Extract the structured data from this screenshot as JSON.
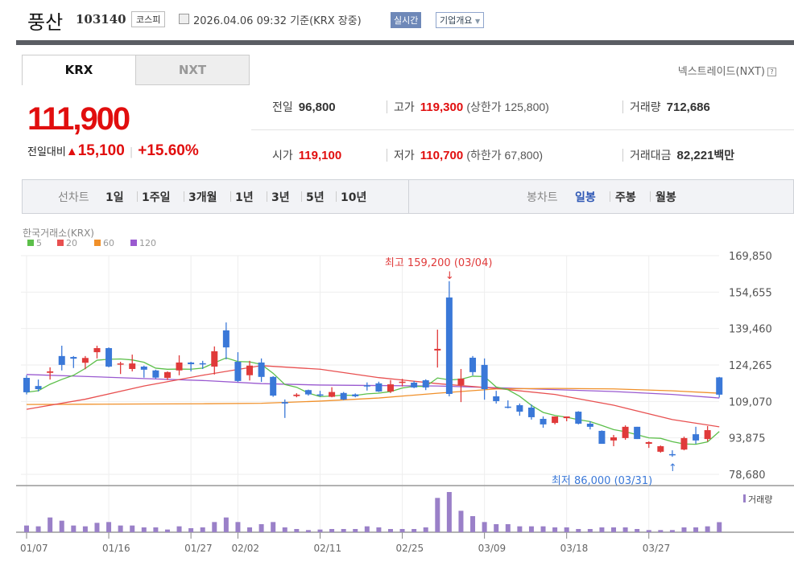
{
  "header": {
    "name": "풍산",
    "code": "103140",
    "market": "코스피",
    "datetime": "2026.04.06 09:32",
    "basis": "기준(KRX 장중)",
    "realtime": "실시간",
    "corp_info": "기업개요",
    "calendar_icon": "calendar-icon"
  },
  "tabs": [
    {
      "label": "KRX",
      "active": true
    },
    {
      "label": "NXT",
      "active": false
    }
  ],
  "nxt_link": "넥스트레이드(NXT)",
  "help": "?",
  "quote": {
    "price": "111,900",
    "change_label": "전일대비",
    "change_arrow": "▲",
    "change": "15,100",
    "change_pct": "+15.60%",
    "prev_label": "전일",
    "prev": "96,800",
    "high_label": "고가",
    "high": "119,300",
    "upper_limit": "(상한가 125,800)",
    "volume_label": "거래량",
    "volume": "712,686",
    "open_label": "시가",
    "open": "119,100",
    "low_label": "저가",
    "low": "110,700",
    "lower_limit": "(하한가 67,800)",
    "amount_label": "거래대금",
    "amount": "82,221",
    "amount_unit": "백만"
  },
  "toolbar": {
    "line_label": "선차트",
    "line_periods": [
      "1일",
      "1주일",
      "3개월",
      "1년",
      "3년",
      "5년",
      "10년"
    ],
    "candle_label": "봉차트",
    "candle_periods": [
      "일봉",
      "주봉",
      "월봉"
    ],
    "active_candle": "일봉"
  },
  "colors": {
    "up": "#e03a3a",
    "down": "#3a78d8",
    "ma5": "#5cbf4a",
    "ma20": "#e85050",
    "ma60": "#f0902a",
    "ma120": "#9a5ad0",
    "volume": "#9a80c8"
  },
  "chart_data": {
    "type": "candlestick",
    "exchange_label": "한국거래소(KRX)",
    "legend": [
      "5",
      "20",
      "60",
      "120"
    ],
    "ylim": [
      78680,
      169850
    ],
    "yticks": [
      "169,850",
      "154,655",
      "139,460",
      "124,265",
      "109,070",
      "93,875",
      "78,680"
    ],
    "xtick_labels": [
      {
        "index": 0,
        "label": "01/07"
      },
      {
        "index": 7,
        "label": "01/16"
      },
      {
        "index": 14,
        "label": "01/27"
      },
      {
        "index": 18,
        "label": "02/02"
      },
      {
        "index": 25,
        "label": "02/11"
      },
      {
        "index": 32,
        "label": "02/25"
      },
      {
        "index": 39,
        "label": "03/09"
      },
      {
        "index": 46,
        "label": "03/18"
      },
      {
        "index": 53,
        "label": "03/27"
      }
    ],
    "high_annotation": {
      "index": 36,
      "label": "최고 159,200 (03/04)",
      "value": 159200
    },
    "low_annotation": {
      "index": 55,
      "label": "최저 86,000 (03/31)",
      "value": 86000
    },
    "volume_label": "거래량",
    "ohlc": [
      [
        118900,
        120000,
        112000,
        112900
      ],
      [
        115500,
        118200,
        113200,
        114200
      ],
      [
        121000,
        123300,
        118200,
        121600
      ],
      [
        128000,
        132300,
        122000,
        124300
      ],
      [
        127600,
        128000,
        123000,
        126900
      ],
      [
        125200,
        128000,
        122500,
        127200
      ],
      [
        129600,
        132300,
        127000,
        131300
      ],
      [
        131300,
        131600,
        123300,
        123600
      ],
      [
        124400,
        125600,
        120500,
        124900
      ],
      [
        122600,
        128600,
        121600,
        124900
      ],
      [
        123600,
        124000,
        119000,
        122300
      ],
      [
        122000,
        122300,
        118600,
        119000
      ],
      [
        118900,
        121600,
        118000,
        121300
      ],
      [
        122000,
        128300,
        120000,
        125300
      ],
      [
        125300,
        125600,
        121600,
        124600
      ],
      [
        125000,
        126000,
        122600,
        124600
      ],
      [
        123600,
        132000,
        120300,
        130000
      ],
      [
        138700,
        142000,
        126600,
        131600
      ],
      [
        125600,
        129600,
        117200,
        117600
      ],
      [
        120000,
        126000,
        117800,
        124000
      ],
      [
        125300,
        127000,
        117200,
        119300
      ],
      [
        119300,
        119600,
        111000,
        111500
      ],
      [
        108800,
        109900,
        102200,
        108200
      ],
      [
        111300,
        112500,
        110800,
        111900
      ],
      [
        113800,
        114000,
        111500,
        112000
      ],
      [
        112000,
        113500,
        111000,
        111700
      ],
      [
        111000,
        115000,
        110800,
        113000
      ],
      [
        112600,
        113000,
        109600,
        109900
      ],
      [
        112000,
        112400,
        110800,
        111200
      ],
      [
        115800,
        117000,
        113600,
        115400
      ],
      [
        116600,
        117300,
        113000,
        113200
      ],
      [
        113200,
        118000,
        112600,
        116200
      ],
      [
        117000,
        118500,
        115300,
        117300
      ],
      [
        116900,
        117600,
        114600,
        114900
      ],
      [
        117900,
        118300,
        113800,
        114900
      ],
      [
        130300,
        139000,
        123200,
        131000
      ],
      [
        152400,
        159200,
        111200,
        112200
      ],
      [
        115900,
        122600,
        108800,
        118600
      ],
      [
        127300,
        128000,
        119900,
        121300
      ],
      [
        124300,
        127000,
        109800,
        114200
      ],
      [
        111200,
        113500,
        108200,
        109200
      ],
      [
        106900,
        109500,
        106200,
        106500
      ],
      [
        107500,
        108200,
        103100,
        104800
      ],
      [
        106500,
        107800,
        101500,
        102500
      ],
      [
        101800,
        102800,
        98100,
        99500
      ],
      [
        100100,
        102800,
        99500,
        102800
      ],
      [
        102100,
        102800,
        100800,
        102800
      ],
      [
        104800,
        105000,
        99500,
        99800
      ],
      [
        99800,
        100800,
        97400,
        98500
      ],
      [
        96800,
        97000,
        91400,
        91400
      ],
      [
        92800,
        95100,
        90400,
        94100
      ],
      [
        93800,
        99100,
        93100,
        98500
      ],
      [
        98500,
        98500,
        93400,
        93400
      ],
      [
        91400,
        92400,
        89700,
        92100
      ],
      [
        88100,
        90700,
        87700,
        90400
      ],
      [
        87100,
        88700,
        86000,
        87000
      ],
      [
        89000,
        94400,
        88700,
        93800
      ],
      [
        95400,
        98500,
        91400,
        92800
      ],
      [
        93400,
        98800,
        92400,
        97100
      ],
      [
        119100,
        119300,
        110700,
        111900
      ]
    ],
    "ma_sample_every": 5,
    "ma20": [
      105800,
      110000,
      115500,
      120000,
      124000,
      122500,
      119000,
      116500,
      114500,
      112000,
      107500,
      101500,
      98500
    ],
    "ma60": [
      107800,
      107900,
      108000,
      108100,
      108300,
      109200,
      110500,
      112500,
      114300,
      114500,
      114300,
      113500,
      112500
    ],
    "ma120": [
      120300,
      119500,
      118600,
      117800,
      116500,
      115900,
      115700,
      115500,
      114800,
      114000,
      113200,
      112000,
      110500
    ],
    "volume_k": [
      475,
      418,
      1045,
      817,
      475,
      418,
      665,
      722,
      475,
      475,
      342,
      342,
      190,
      418,
      285,
      342,
      722,
      1045,
      722,
      342,
      570,
      722,
      342,
      228,
      152,
      190,
      228,
      228,
      228,
      418,
      342,
      228,
      228,
      228,
      342,
      2432,
      2850,
      1520,
      1140,
      722,
      570,
      570,
      418,
      418,
      418,
      342,
      342,
      228,
      228,
      342,
      342,
      342,
      228,
      152,
      152,
      152,
      342,
      342,
      418,
      713
    ]
  }
}
